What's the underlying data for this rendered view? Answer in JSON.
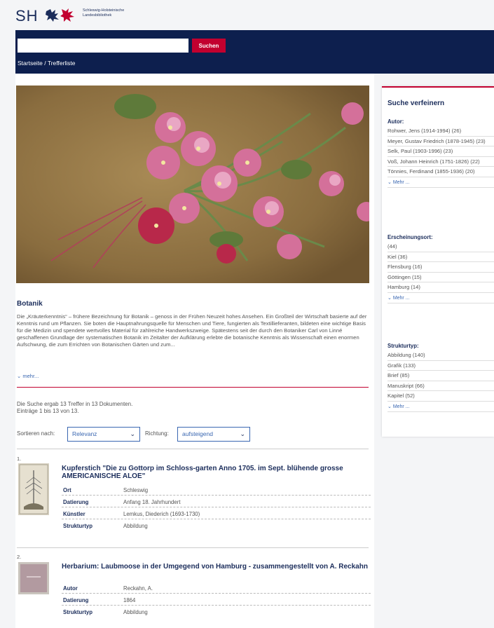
{
  "header": {
    "logo_sh": "SH",
    "logo_line1": "Schleswig-Holsteinische",
    "logo_line2": "Landesbibliothek"
  },
  "search": {
    "value": "",
    "button_label": "Suchen"
  },
  "breadcrumb": {
    "home": "Startseite",
    "separator": " / ",
    "current": "Trefferliste"
  },
  "topic": {
    "title": "Botanik",
    "text": "Die „Kräuterkenntnis“ – frühere Bezeichnung für Botanik – genoss in der Frühen Neuzeit hohes Ansehen. Ein Großteil der Wirtschaft basierte auf der Kenntnis rund um Pflanzen. Sie boten die Hauptnahrungsquelle für Menschen und Tiere, fungierten als Textillieferanten, bildeten eine wichtige Basis für die Medizin und spendete wertvolles Material für zahlreiche Handwerkszweige. Spätestens seit der durch den Botaniker Carl von Linné geschaffenen Grundlage der systematischen Botanik im Zeitalter der Aufklärung erlebte die botanische Kenntnis als Wissenschaft einen enormen Aufschwung, die zum Errichten von Botanischen Gärten und zum...",
    "more_label": "mehr..."
  },
  "results_info": {
    "line1": "Die Suche ergab 13 Treffer in 13 Dokumenten.",
    "line2": "Einträge 1 bis 13 von 13."
  },
  "sort": {
    "label": "Sortieren nach:",
    "selected": "Relevanz",
    "direction_label": "Richtung:",
    "direction_selected": "aufsteigend"
  },
  "results": [
    {
      "number": "1.",
      "title": "Kupferstich \"Die zu Gottorp im Schloss-garten Anno 1705. im Sept. blühende grosse AMERICANISCHE ALOE\"",
      "fields": [
        {
          "label": "Ort",
          "value": "Schleswig"
        },
        {
          "label": "Datierung",
          "value": "Anfang 18. Jahrhundert"
        },
        {
          "label": "Künstler",
          "value": "Lemkus, Diederich (1693-1730)"
        },
        {
          "label": "Strukturtyp",
          "value": "Abbildung"
        }
      ]
    },
    {
      "number": "2.",
      "title": "Herbarium: Laubmoose in der Umgegend von Hamburg - zusammengestellt von A. Reckahn",
      "fields": [
        {
          "label": "Autor",
          "value": "Reckahn, A."
        },
        {
          "label": "Datierung",
          "value": "1864"
        },
        {
          "label": "Strukturtyp",
          "value": "Abbildung"
        }
      ]
    }
  ],
  "sidebar": {
    "title": "Suche verfeinern",
    "more_label": "Mehr ...",
    "facets": [
      {
        "title": "Autor:",
        "items": [
          "Rohwer, Jens (1914-1994) (26)",
          "Meyer, Gustav Friedrich (1878-1945) (23)",
          "Selk, Paul (1903-1996) (23)",
          "Voß, Johann Heinrich (1751-1826) (22)",
          "Tönnies, Ferdinand (1855-1936) (20)"
        ]
      },
      {
        "title": "Erscheinungsort:",
        "items": [
          "(44)",
          "Kiel (36)",
          "Flensburg (16)",
          "Göttingen (15)",
          "Hamburg (14)"
        ]
      },
      {
        "title": "Strukturtyp:",
        "items": [
          "Abbildung (140)",
          "Grafik (133)",
          "Brief (85)",
          "Manuskript (66)",
          "Kapitel (52)"
        ]
      }
    ]
  },
  "colors": {
    "navy": "#0d1f4e",
    "accent_red": "#c2002f",
    "link_blue": "#3a67b1"
  }
}
